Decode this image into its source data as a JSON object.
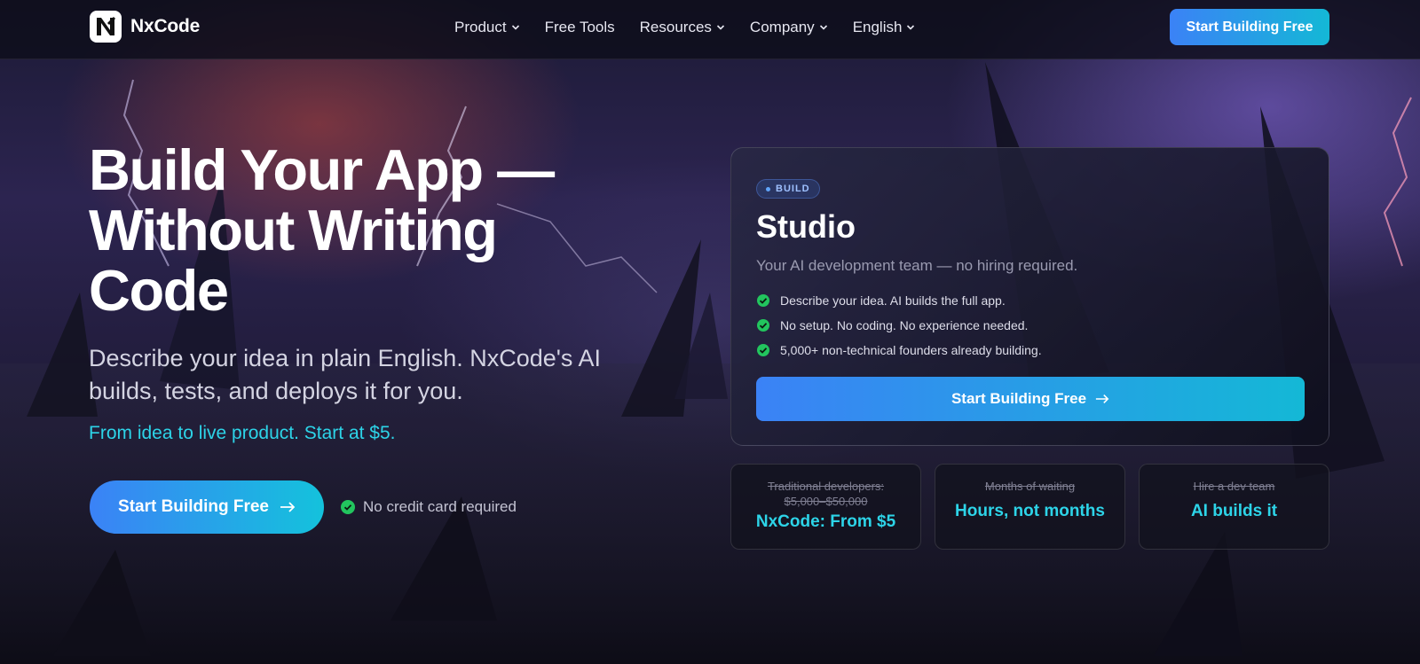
{
  "nav": {
    "brand": "NxCode",
    "links": [
      {
        "label": "Product",
        "dropdown": true
      },
      {
        "label": "Free Tools",
        "dropdown": false
      },
      {
        "label": "Resources",
        "dropdown": true
      },
      {
        "label": "Company",
        "dropdown": true
      },
      {
        "label": "English",
        "dropdown": true
      }
    ],
    "cta": "Start Building Free"
  },
  "hero": {
    "title_lines": [
      "Build Your App —",
      "Without Writing",
      "Code"
    ],
    "subtitle": "Describe your idea in plain English. NxCode's AI builds, tests, and deploys it for you.",
    "accent": "From idea to live product. Start at $5.",
    "cta": "Start Building Free",
    "note": "No credit card required"
  },
  "card": {
    "badge": "BUILD",
    "title": "Studio",
    "subtitle": "Your AI development team — no hiring required.",
    "features": [
      "Describe your idea. AI builds the full app.",
      "No setup. No coding. No experience needed.",
      "5,000+ non-technical founders already building."
    ],
    "cta": "Start Building Free"
  },
  "stats": [
    {
      "old": "Traditional developers: $5,000–$50,000",
      "new": "NxCode: From $5"
    },
    {
      "old": "Months of waiting",
      "new": "Hours, not months"
    },
    {
      "old": "Hire a dev team",
      "new": "AI builds it"
    }
  ],
  "colors": {
    "accent_cyan": "#2dd4e8",
    "gradient_start": "#3b82f6",
    "gradient_end": "#14b8d6",
    "check_green": "#22c55e"
  },
  "icons": {
    "logo": "nx-logo-icon",
    "dropdown": "chevron-down-icon",
    "arrow": "arrow-right-icon",
    "check": "check-circle-icon"
  }
}
